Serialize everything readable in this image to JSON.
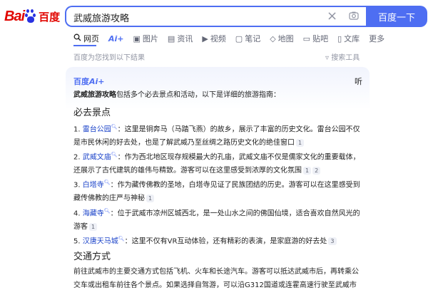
{
  "logo": {
    "text_left": "Bai",
    "text_right": "百度"
  },
  "search": {
    "query": "武威旅游攻略",
    "button_label": "百度一下"
  },
  "tabs": [
    {
      "label": "网页",
      "icon": "search-icon"
    },
    {
      "label": "Ai+",
      "icon": "ai-icon"
    },
    {
      "label": "图片",
      "icon": "image-icon"
    },
    {
      "label": "资讯",
      "icon": "news-icon"
    },
    {
      "label": "视频",
      "icon": "video-icon"
    },
    {
      "label": "笔记",
      "icon": "note-icon"
    },
    {
      "label": "地图",
      "icon": "map-icon"
    },
    {
      "label": "贴吧",
      "icon": "tieba-icon"
    },
    {
      "label": "文库",
      "icon": "doc-icon"
    },
    {
      "label": "更多",
      "icon": ""
    }
  ],
  "result_info": "百度为您找到以下结果",
  "search_tools": "搜索工具",
  "ai_card": {
    "logo_bd": "百度",
    "logo_ai": "Ai+",
    "listen": "听",
    "intro_bold": "武威旅游攻略",
    "intro_rest": "包括多个必去景点和活动，以下是详细的旅游指南：",
    "section1": "必去景点",
    "items": [
      {
        "num": "1.",
        "name": "雷台公园",
        "line1": "：这里是铜奔马（马踏飞燕）的故乡，展示了丰富的历史文化。雷台公园不仅",
        "line2": "是市民休闲的好去处，也是了解武威乃至丝绸之路历史文化的绝佳窗口",
        "cites": [
          "1"
        ]
      },
      {
        "num": "2.",
        "name": "武威文庙",
        "line1": "：作为西北地区现存规模最大的孔庙，武威文庙不仅是儒家文化的重要载体，",
        "line2": "还展示了古代建筑的雄伟与精致。游客可以在这里感受到浓厚的文化氛围",
        "cites": [
          "1",
          "2"
        ]
      },
      {
        "num": "3.",
        "name": "白塔寺",
        "line1": "：作为藏传佛教的圣地，白塔寺见证了民族团结的历史。游客可以在这里感受到",
        "line2": "藏传佛教的庄严与神秘",
        "cites": [
          "1"
        ]
      },
      {
        "num": "4.",
        "name": "海藏寺",
        "line1": "：位于武威市凉州区城西北，是一处山水之间的佛国仙境，适合喜欢自然风光的",
        "line2": "游客",
        "cites": [
          "1"
        ]
      },
      {
        "num": "5.",
        "name": "汉唐天马城",
        "line1": "：这里不仅有VR互动体验，还有精彩的表演，是家庭游的好去处",
        "line2": "",
        "cites": [
          "3"
        ]
      }
    ],
    "section2": "交通方式",
    "transport_line1": "前往武威市的主要交通方式包括飞机、火车和长途汽车。游客可以抵达武威市后，再转乘公",
    "transport_line2": "交车或出租车前往各个景点。如果选择自驾游，可以沿G312国道或连霍高速行驶至武威市"
  }
}
